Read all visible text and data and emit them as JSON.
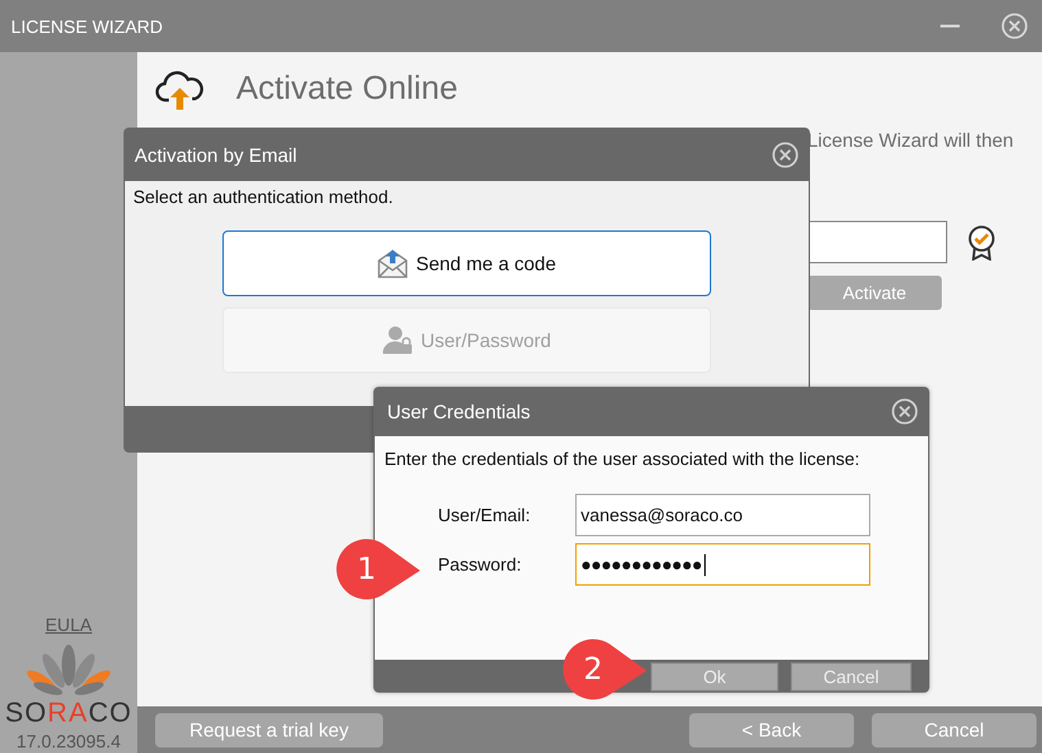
{
  "window": {
    "title": "LICENSE WIZARD"
  },
  "page": {
    "heading": "Activate Online",
    "intro_fragment": "License Wizard will then",
    "activate_button": "Activate"
  },
  "sidebar": {
    "eula_link": "EULA",
    "logo": [
      {
        "text": "SO",
        "accent": false
      },
      {
        "text": "RA",
        "accent": true
      },
      {
        "text": "CO",
        "accent": false
      }
    ],
    "version": "17.0.23095.4"
  },
  "footer_buttons": [
    {
      "label": "Request a trial key",
      "kind": "left"
    },
    {
      "label": "< Back",
      "kind": "right"
    },
    {
      "label": "Cancel",
      "kind": "right"
    }
  ],
  "email_dialog": {
    "title": "Activation by Email",
    "prompt": "Select an authentication method.",
    "options": [
      {
        "label": "Send me a code",
        "kind": "email",
        "selected": true,
        "disabled": false
      },
      {
        "label": "User/Password",
        "kind": "user",
        "selected": false,
        "disabled": true
      }
    ]
  },
  "credentials_dialog": {
    "title": "User Credentials",
    "prompt": "Enter the credentials of the user associated with the license:",
    "fields": [
      {
        "label": "User/Email:",
        "value": "vanessa@soraco.co",
        "focused": false
      },
      {
        "label": "Password:",
        "value": "●●●●●●●●●●●●",
        "focused": true
      }
    ],
    "buttons": [
      "Ok",
      "Cancel"
    ]
  },
  "callouts": [
    {
      "number": "1"
    },
    {
      "number": "2"
    }
  ]
}
